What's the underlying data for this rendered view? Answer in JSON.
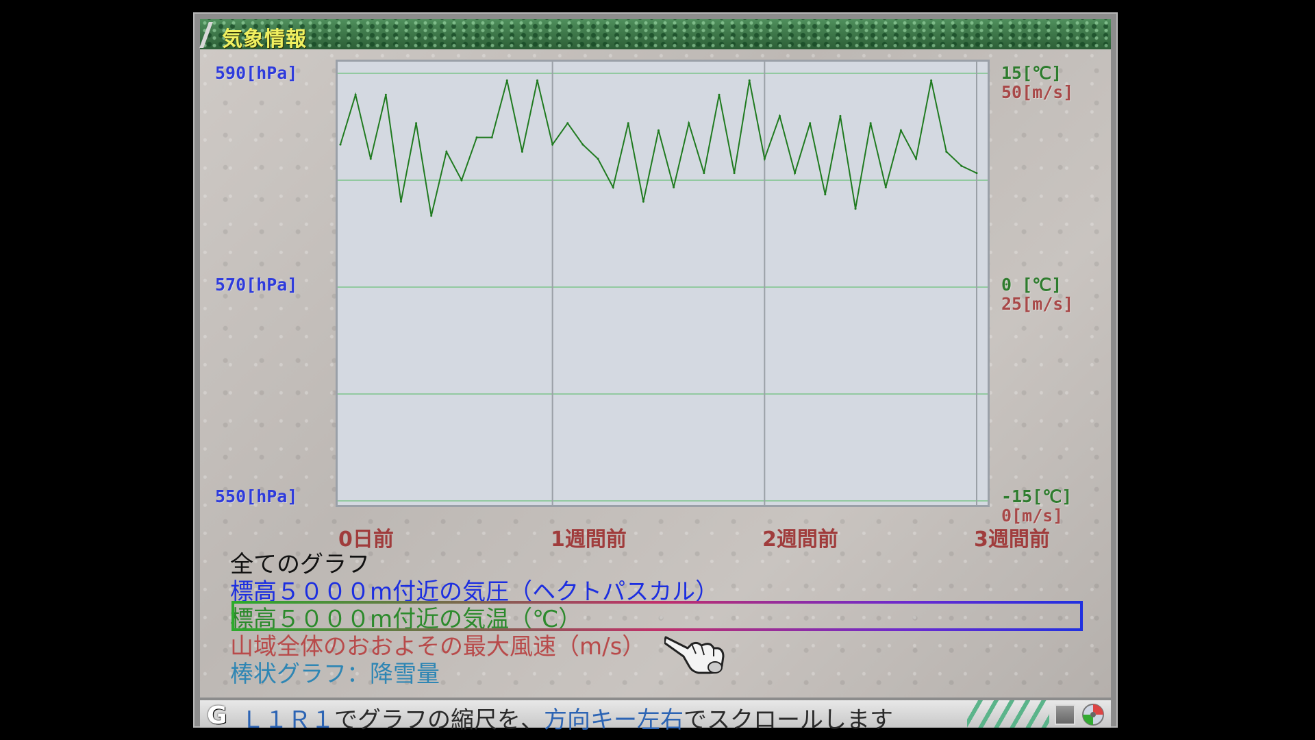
{
  "window": {
    "title": "気象情報"
  },
  "axes": {
    "left": [
      "590[hPa]",
      "570[hPa]",
      "550[hPa]"
    ],
    "right_temp": [
      "15[℃]",
      "0 [℃]",
      "-15[℃]"
    ],
    "right_wind": [
      "50[m/s]",
      "25[m/s]",
      "0[m/s]"
    ],
    "x": [
      "0日前",
      "1週間前",
      "2週間前",
      "3週間前"
    ]
  },
  "legend": {
    "all": "全てのグラフ",
    "pressure": "標高５０００m付近の気圧（ヘクトパスカル）",
    "temperature": "標高５０００m付近の気温（℃）",
    "wind": "山域全体のおおよその最大風速（m/s）",
    "snow": "棒状グラフ：降雪量",
    "selected": "temperature"
  },
  "status": {
    "button": "G",
    "part1": "Ｌ１Ｒ１",
    "part2": "でグラフの縮尺を、",
    "part3": "方向キー左右",
    "part4": "でスクロールします"
  },
  "colors": {
    "temperature_line": "#1f7a1f",
    "pressure_label": "#2e3bdc",
    "wind_label": "#a84848",
    "plot_bg": "#d4d9e1"
  },
  "chart_data": {
    "type": "line",
    "xlabel": "",
    "ylabel": "",
    "x": [
      0,
      0.5,
      1,
      1.5,
      2,
      2.5,
      3,
      3.5,
      4,
      4.5,
      5,
      5.5,
      6,
      6.5,
      7,
      7.5,
      8,
      8.5,
      9,
      9.5,
      10,
      10.5,
      11,
      11.5,
      12,
      12.5,
      13,
      13.5,
      14,
      14.5,
      15,
      15.5,
      16,
      16.5,
      17,
      17.5,
      18,
      18.5,
      19,
      19.5,
      20,
      20.5,
      21
    ],
    "x_unit": "days ago",
    "ylim": [
      -15,
      15
    ],
    "series": [
      {
        "values": [
          10,
          13.5,
          9,
          13.5,
          6,
          11.5,
          5,
          9.5,
          7.5,
          10.5,
          10.5,
          14.5,
          9.5,
          14.5,
          10,
          11.5,
          10,
          9,
          7,
          11.5,
          6,
          11,
          7,
          11.5,
          8,
          13.5,
          8,
          14.5,
          9,
          12,
          8,
          11.5,
          6.5,
          12,
          5.5,
          11.5,
          7,
          11,
          9,
          14.5,
          9.5,
          8.5,
          8
        ]
      }
    ]
  }
}
